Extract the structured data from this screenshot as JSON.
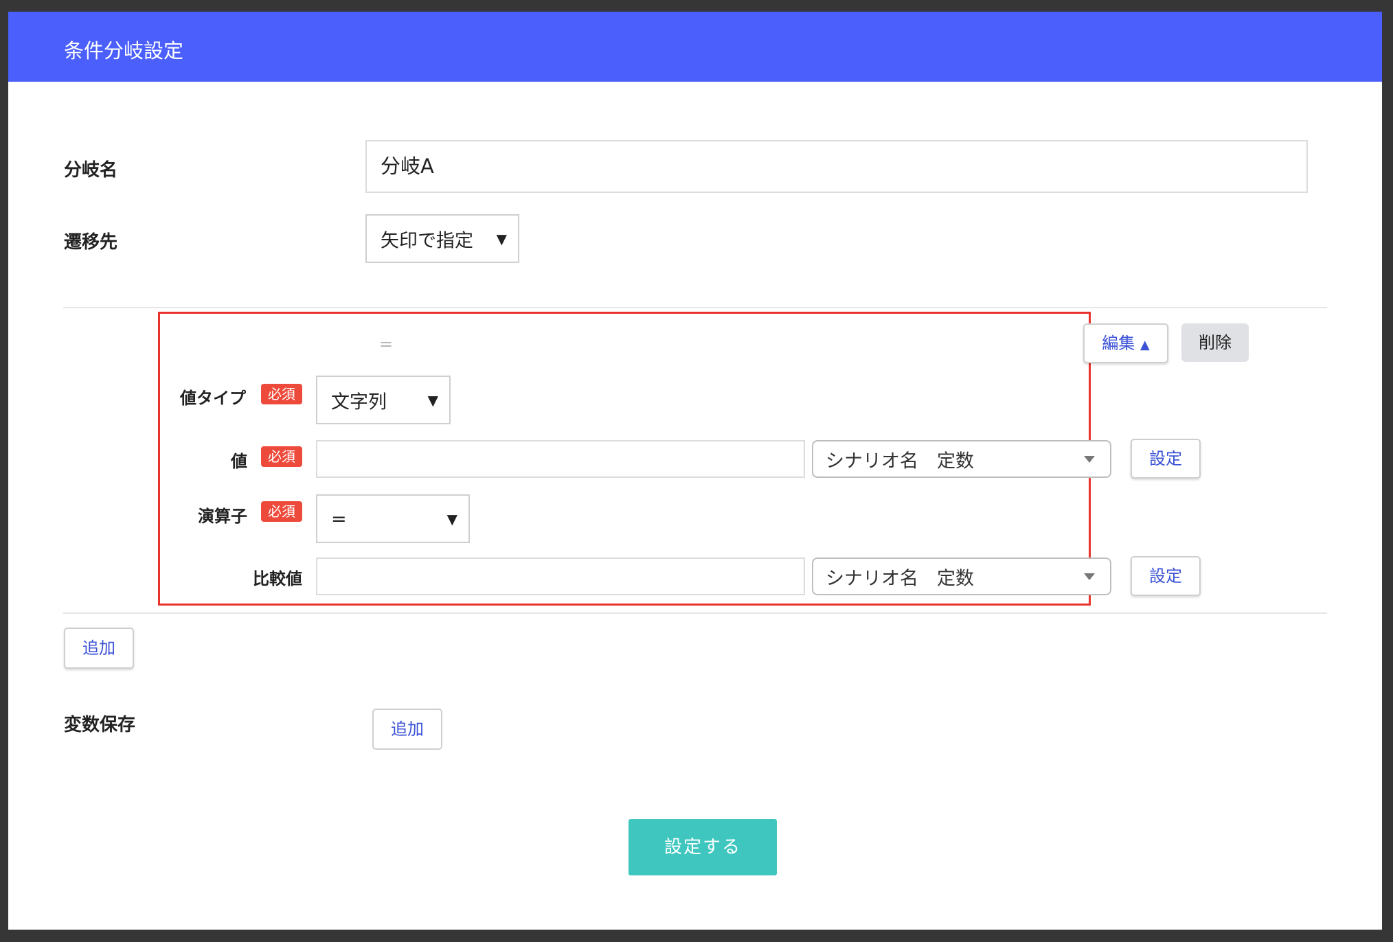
{
  "modal": {
    "title": "条件分岐設定"
  },
  "form": {
    "branch_name_label": "分岐名",
    "branch_name_value": "分岐A",
    "destination_label": "遷移先",
    "destination_value": "矢印で指定"
  },
  "condition": {
    "drag_handle": "=",
    "edit_button": "編集",
    "edit_caret": "▲",
    "delete_button": "削除",
    "value_type_label": "値タイプ",
    "value_type_value": "文字列",
    "value_label": "値",
    "value_input": "",
    "value_source_select": "シナリオ名　定数",
    "value_set_button": "設定",
    "operator_label": "演算子",
    "operator_value": "=",
    "compare_label": "比較値",
    "compare_input": "",
    "compare_source_select": "シナリオ名　定数",
    "compare_set_button": "設定",
    "required_badge": "必須",
    "select_caret": "▼"
  },
  "add_condition_button": "追加",
  "variable_save": {
    "label": "変数保存",
    "add_button": "追加"
  },
  "submit_button": "設定する",
  "colors": {
    "header": "#4a5ffc",
    "required": "#ee4a3b",
    "primary": "#3ec6bf",
    "highlight": "#e8322c",
    "link": "#3b52d6"
  }
}
